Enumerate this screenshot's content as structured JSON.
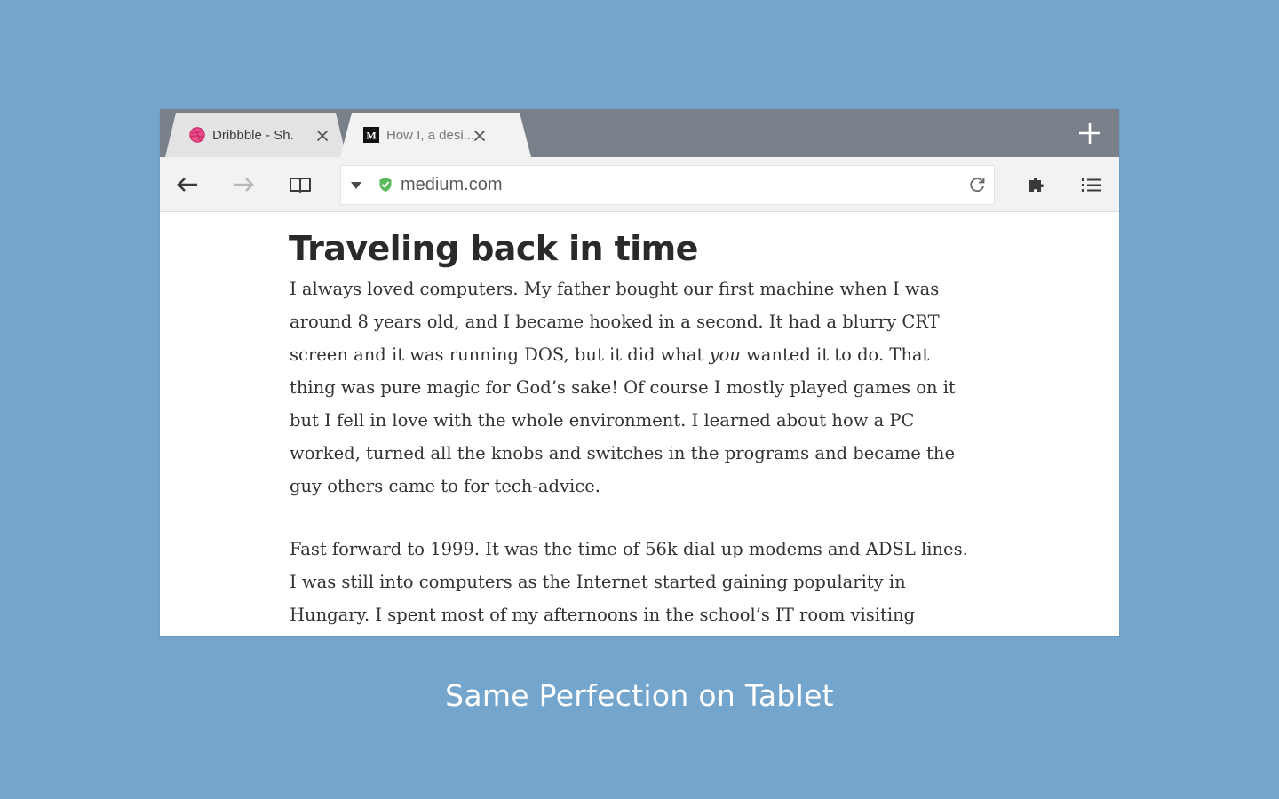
{
  "colors": {
    "background": "#74a5cd",
    "tabstrip": "#798089",
    "inactive_tab": "#e3e3e3",
    "active_tab": "#f2f2f2",
    "secure_green": "#5cb85c"
  },
  "tabs": [
    {
      "title": "Dribbble - Sh.",
      "favicon": "dribbble-icon",
      "active": false
    },
    {
      "title": "How I, a desi...",
      "favicon": "medium-icon",
      "favicon_text": "M",
      "active": true
    }
  ],
  "toolbar": {
    "back_icon": "arrow-left-icon",
    "forward_icon": "arrow-right-icon",
    "reader_icon": "book-icon",
    "extensions_icon": "puzzle-icon",
    "menu_icon": "list-icon"
  },
  "omnibox": {
    "url": "medium.com",
    "secure_icon": "shield-check-icon",
    "reload_icon": "reload-icon"
  },
  "article": {
    "heading": "Traveling back in time",
    "p1": {
      "l1": "I always loved computers. My father bought our first machine when I was",
      "l2": "around 8 years old, and I became hooked in a second. It had a blurry CRT",
      "l3a": "screen and it was running DOS, but it did what ",
      "l3em": "you",
      "l3b": " wanted it to do. That",
      "l4": "thing was pure magic for God’s sake! Of course I mostly played games on it",
      "l5": "but I fell in love with the whole environment. I learned about how a PC",
      "l6": "worked, turned all the knobs and switches in the programs and became the",
      "l7": "guy others came to for tech-advice."
    },
    "p2": {
      "l1": "Fast forward to 1999. It was the time of 56k dial up modems and ADSL lines.",
      "l2": "I was still into computers as the Internet started gaining popularity in",
      "l3": "Hungary. I spent most of my afternoons in the school’s IT room visiting"
    }
  },
  "caption": "Same Perfection on Tablet"
}
